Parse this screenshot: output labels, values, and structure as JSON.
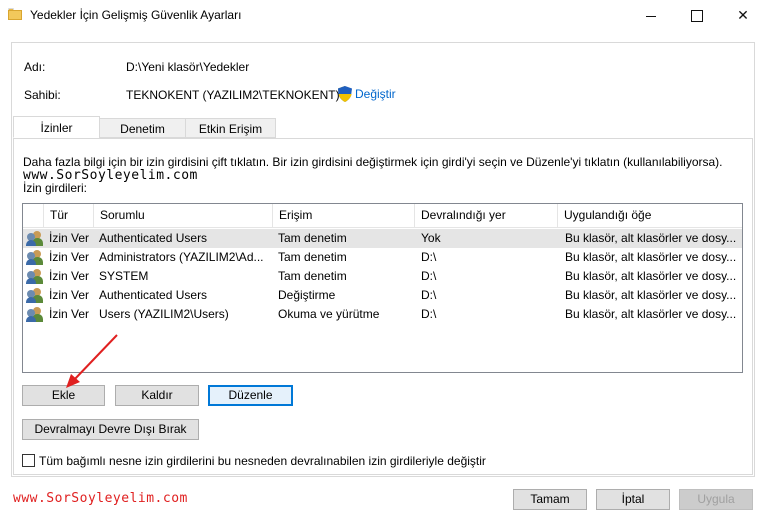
{
  "window": {
    "title": "Yedekler İçin Gelişmiş Güvenlik Ayarları",
    "icon": "folder-icon",
    "minimize": "–",
    "maximize": "□",
    "close": "✕"
  },
  "info": {
    "name_label": "Adı:",
    "name_value": "D:\\Yeni klasör\\Yedekler",
    "owner_label": "Sahibi:",
    "owner_value": "TEKNOKENT (YAZILIM2\\TEKNOKENT)",
    "change_link": "Değiştir"
  },
  "tabs": [
    {
      "label": "İzinler",
      "active": true
    },
    {
      "label": "Denetim",
      "active": false
    },
    {
      "label": "Etkin Erişim",
      "active": false
    }
  ],
  "permissions": {
    "description": "Daha fazla bilgi için bir izin girdisini çift tıklatın. Bir izin girdisini değiştirmek için girdi'yi seçin ve Düzenle'yi tıklatın (kullanılabiliyorsa).",
    "watermark_top": "www.SorSoyleyelim.com",
    "entries_label": "İzin girdileri:",
    "columns": [
      "Tür",
      "Sorumlu",
      "Erişim",
      "Devralındığı yer",
      "Uygulandığı öğe"
    ],
    "rows": [
      {
        "type": "İzin Ver",
        "principal": "Authenticated Users",
        "access": "Tam denetim",
        "inherited": "Yok",
        "applies": "Bu klasör, alt klasörler ve dosy...",
        "selected": true
      },
      {
        "type": "İzin Ver",
        "principal": "Administrators (YAZILIM2\\Ad...",
        "access": "Tam denetim",
        "inherited": "D:\\",
        "applies": "Bu klasör, alt klasörler ve dosy...",
        "selected": false
      },
      {
        "type": "İzin Ver",
        "principal": "SYSTEM",
        "access": "Tam denetim",
        "inherited": "D:\\",
        "applies": "Bu klasör, alt klasörler ve dosy...",
        "selected": false
      },
      {
        "type": "İzin Ver",
        "principal": "Authenticated Users",
        "access": "Değiştirme",
        "inherited": "D:\\",
        "applies": "Bu klasör, alt klasörler ve dosy...",
        "selected": false
      },
      {
        "type": "İzin Ver",
        "principal": "Users (YAZILIM2\\Users)",
        "access": "Okuma ve yürütme",
        "inherited": "D:\\",
        "applies": "Bu klasör, alt klasörler ve dosy...",
        "selected": false
      }
    ],
    "add_button": "Ekle",
    "remove_button": "Kaldır",
    "edit_button": "Düzenle",
    "disable_inheritance_button": "Devralmayı Devre Dışı Bırak",
    "replace_checkbox_label": "Tüm bağımlı nesne izin girdilerini bu nesneden devralınabilen izin girdileriyle değiştir",
    "replace_checkbox_checked": false
  },
  "footer": {
    "watermark_bottom": "www.SorSoyleyelim.com",
    "ok_button": "Tamam",
    "cancel_button": "İptal",
    "apply_button": "Uygula"
  },
  "colors": {
    "accent": "#0078d7",
    "link": "#0066cc",
    "watermark_top": "#000000",
    "watermark_bottom": "#e02020",
    "arrow": "#e02020"
  }
}
